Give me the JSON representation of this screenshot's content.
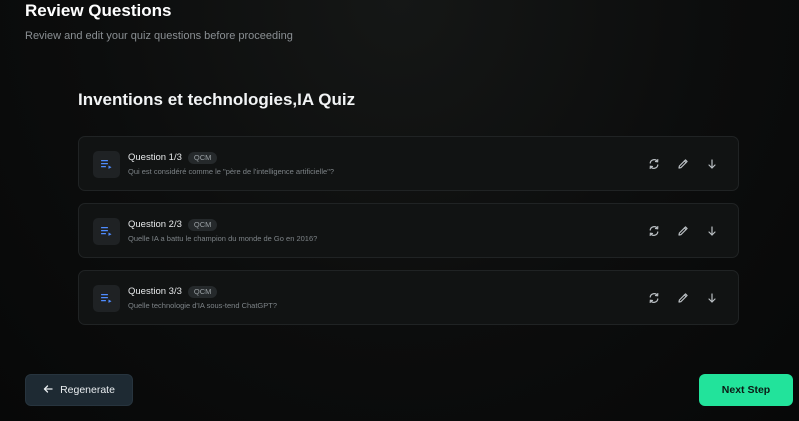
{
  "header": {
    "title": "Review Questions",
    "subtitle": "Review and edit your quiz questions before proceeding"
  },
  "quiz": {
    "title": "Inventions et technologies,IA Quiz"
  },
  "questions": [
    {
      "label": "Question 1/3",
      "type": "QCM",
      "text": "Qui est considéré comme le \"père de l'intelligence artificielle\"?"
    },
    {
      "label": "Question 2/3",
      "type": "QCM",
      "text": "Quelle IA a battu le champion du monde de Go en 2016?"
    },
    {
      "label": "Question 3/3",
      "type": "QCM",
      "text": "Quelle technologie d'IA sous-tend ChatGPT?"
    }
  ],
  "icons": {
    "question": "list-icon",
    "regenerate": "refresh-icon",
    "edit": "pencil-icon",
    "move": "arrow-down-icon",
    "back": "arrow-left-icon"
  },
  "footer": {
    "regenerate_label": "Regenerate",
    "next_label": "Next Step"
  },
  "colors": {
    "accent": "#22e39b",
    "secondary_button": "#1e2a33",
    "card_bg": "#111313"
  }
}
